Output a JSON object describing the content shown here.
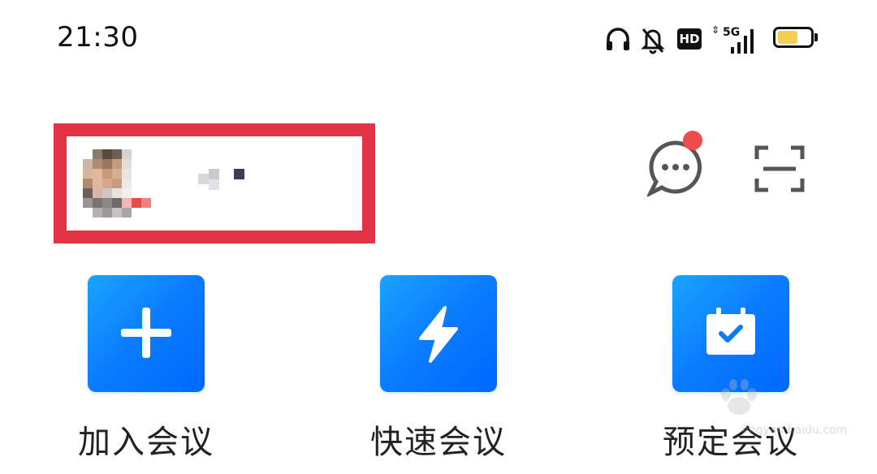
{
  "status_bar": {
    "time": "21:30",
    "network_label": "5G",
    "hd_label": "HD",
    "icons": [
      "headphones-icon",
      "bell-muted-icon",
      "hd-icon",
      "signal-5g-icon",
      "battery-icon"
    ]
  },
  "header": {
    "profile": {
      "avatar": "avatar-pixelated",
      "name": ""
    },
    "message_icon": "message-bubble-icon",
    "message_badge_color": "#f04c4c",
    "scan_icon": "scan-icon",
    "highlight_color": "#e33445"
  },
  "actions": [
    {
      "label": "加入会议",
      "icon": "plus-icon"
    },
    {
      "label": "快速会议",
      "icon": "lightning-icon"
    },
    {
      "label": "预定会议",
      "icon": "calendar-check-icon"
    }
  ],
  "colors": {
    "accent": "#0a7bff",
    "accent_light": "#1aa4ff"
  },
  "watermark": {
    "text": "jingyan.baidu.com"
  }
}
